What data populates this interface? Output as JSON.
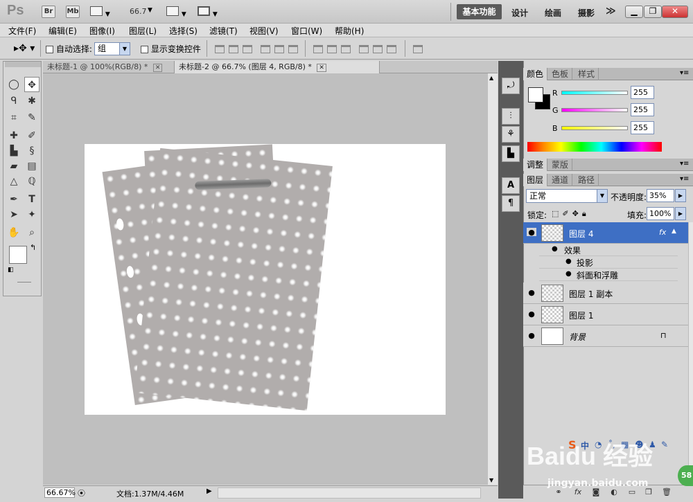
{
  "app": {
    "logo": "Ps",
    "bridge": "Br",
    "minibridge": "Mb",
    "zoom": "66.7",
    "workspaces": {
      "active": "基本功能",
      "design": "设计",
      "painting": "绘画",
      "photography": "摄影",
      "more": "≫"
    }
  },
  "menu": [
    "文件(F)",
    "编辑(E)",
    "图像(I)",
    "图层(L)",
    "选择(S)",
    "滤镜(T)",
    "视图(V)",
    "窗口(W)",
    "帮助(H)"
  ],
  "options": {
    "auto_select_label": "自动选择:",
    "auto_select_value": "组",
    "show_transform_label": "显示变换控件"
  },
  "documents": {
    "tab1": "未标题-1 @ 100%(RGB/8) *",
    "tab2": "未标题-2 @ 66.7% (图层 4, RGB/8) *"
  },
  "status": {
    "zoom": "66.67%",
    "doc": "文档:1.37M/4.46M"
  },
  "color_panel": {
    "tabs": [
      "颜色",
      "色板",
      "样式"
    ],
    "r_label": "R",
    "g_label": "G",
    "b_label": "B",
    "r": "255",
    "g": "255",
    "b": "255",
    "colors": {
      "r": "#00ffff",
      "g": "#ff00ff",
      "b": "#ffff00"
    }
  },
  "adjust_panel": {
    "tabs": [
      "调整",
      "蒙版"
    ]
  },
  "layers_panel": {
    "tabs": [
      "图层",
      "通道",
      "路径"
    ],
    "blend_mode": "正常",
    "opacity_label": "不透明度:",
    "opacity": "35%",
    "lock_label": "锁定:",
    "fill_label": "填充:",
    "fill": "100%",
    "layers": [
      {
        "name": "图层 4",
        "fx": "fx"
      },
      {
        "name": "图层 1 副本"
      },
      {
        "name": "图层 1"
      },
      {
        "name": "背景"
      }
    ],
    "effects_label": "效果",
    "effects": [
      "投影",
      "斜面和浮雕"
    ]
  },
  "watermark": {
    "text": "Baidu 经验",
    "url": "jingyan.baidu.com",
    "badge": "58"
  }
}
